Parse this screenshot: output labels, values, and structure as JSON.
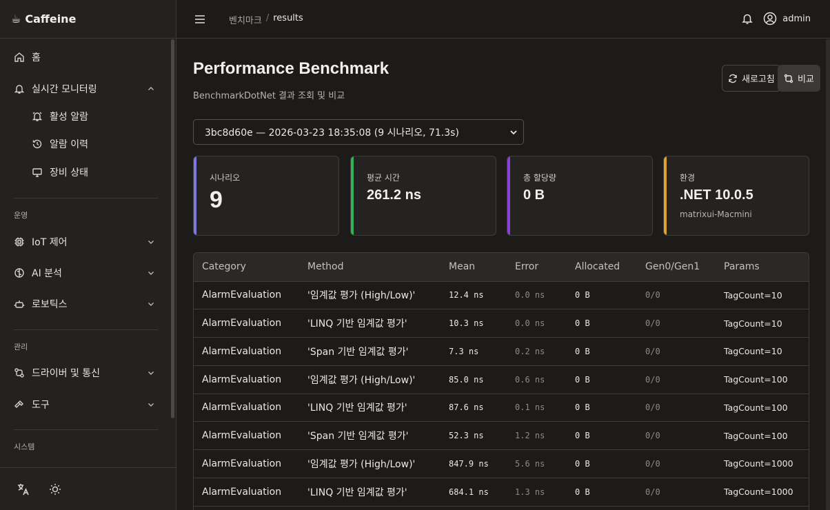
{
  "app": {
    "name": "Caffeine",
    "logo_icon": "coffee-icon"
  },
  "sidebar": {
    "items": [
      {
        "label": "홈",
        "icon": "home-icon"
      },
      {
        "label": "실시간 모니터링",
        "icon": "bell-icon",
        "expanded": true
      },
      {
        "label": "활성 알람",
        "icon": "alarm-icon"
      },
      {
        "label": "알람 이력",
        "icon": "history-icon"
      },
      {
        "label": "장비 상태",
        "icon": "monitor-icon"
      },
      {
        "label": "IoT 제어",
        "icon": "cpu-icon"
      },
      {
        "label": "AI 분석",
        "icon": "brain-icon"
      },
      {
        "label": "로보틱스",
        "icon": "robot-icon"
      },
      {
        "label": "드라이버 및 통신",
        "icon": "network-icon"
      },
      {
        "label": "도구",
        "icon": "hammer-icon"
      }
    ],
    "sections": {
      "ops": "운영",
      "manage": "관리",
      "system": "시스템"
    },
    "bottom": {
      "language_icon": "translate-icon",
      "theme_icon": "sun-icon"
    }
  },
  "topbar": {
    "breadcrumb": [
      "벤치마크",
      "results"
    ],
    "breadcrumb_sep": "/",
    "user": "admin"
  },
  "page": {
    "title": "Performance Benchmark",
    "subtitle": "BenchmarkDotNet 결과 조회 및 비교",
    "refresh_label": "새로고침",
    "compare_label": "비교",
    "run_select": "3bc8d60e — 2026-03-23 18:35:08 (9 시나리오, 71.3s)"
  },
  "cards": [
    {
      "label": "시나리오",
      "value": "9",
      "accent": "#7c7ae0"
    },
    {
      "label": "평균 시간",
      "value": "261.2 ns",
      "accent": "#2fb45a"
    },
    {
      "label": "총 할당량",
      "value": "0 B",
      "accent": "#8a3fd6"
    },
    {
      "label": "환경",
      "value": ".NET 10.0.5",
      "sub": "matrixui-Macmini",
      "accent": "#e0a030"
    }
  ],
  "table": {
    "headers": [
      "Category",
      "Method",
      "Mean",
      "Error",
      "Allocated",
      "Gen0/Gen1",
      "Params"
    ],
    "rows": [
      [
        "AlarmEvaluation",
        "'임계값 평가 (High/Low)'",
        "12.4 ns",
        "0.0 ns",
        "0 B",
        "0/0",
        "TagCount=10"
      ],
      [
        "AlarmEvaluation",
        "'LINQ 기반 임계값 평가'",
        "10.3 ns",
        "0.0 ns",
        "0 B",
        "0/0",
        "TagCount=10"
      ],
      [
        "AlarmEvaluation",
        "'Span 기반 임계값 평가'",
        "7.3 ns",
        "0.2 ns",
        "0 B",
        "0/0",
        "TagCount=10"
      ],
      [
        "AlarmEvaluation",
        "'임계값 평가 (High/Low)'",
        "85.0 ns",
        "0.6 ns",
        "0 B",
        "0/0",
        "TagCount=100"
      ],
      [
        "AlarmEvaluation",
        "'LINQ 기반 임계값 평가'",
        "87.6 ns",
        "0.1 ns",
        "0 B",
        "0/0",
        "TagCount=100"
      ],
      [
        "AlarmEvaluation",
        "'Span 기반 임계값 평가'",
        "52.3 ns",
        "1.2 ns",
        "0 B",
        "0/0",
        "TagCount=100"
      ],
      [
        "AlarmEvaluation",
        "'임계값 평가 (High/Low)'",
        "847.9 ns",
        "5.6 ns",
        "0 B",
        "0/0",
        "TagCount=1000"
      ],
      [
        "AlarmEvaluation",
        "'LINQ 기반 임계값 평가'",
        "684.1 ns",
        "1.3 ns",
        "0 B",
        "0/0",
        "TagCount=1000"
      ]
    ]
  }
}
